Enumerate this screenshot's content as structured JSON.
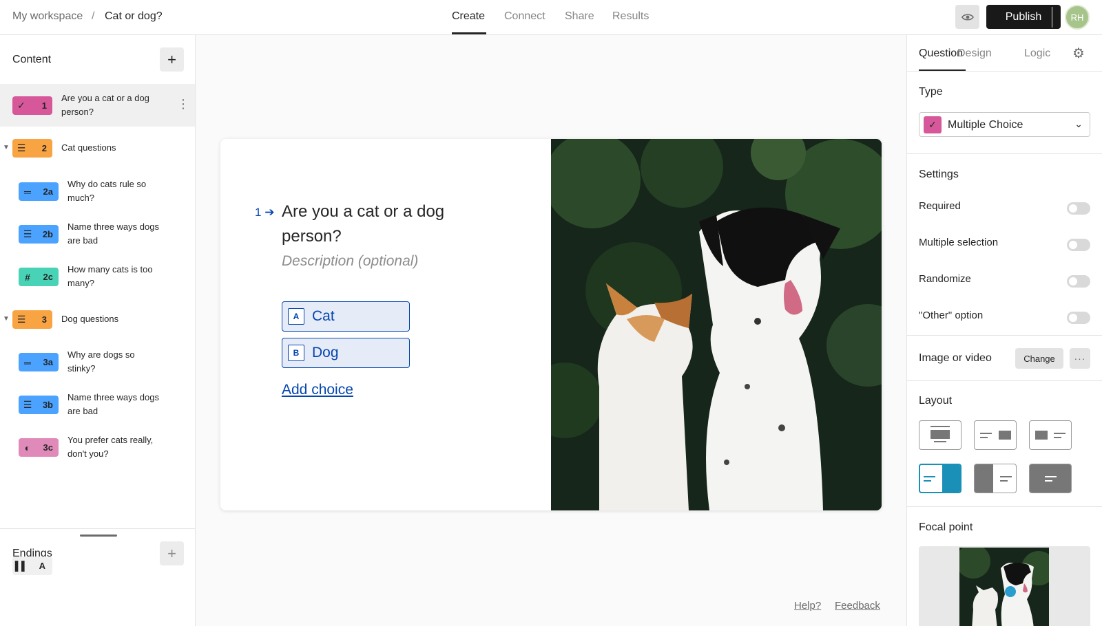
{
  "breadcrumb": {
    "workspace": "My workspace",
    "separator": "/",
    "form": "Cat or dog?"
  },
  "nav": {
    "create": "Create",
    "connect": "Connect",
    "share": "Share",
    "results": "Results"
  },
  "toolbar": {
    "publish_label": "Publish",
    "avatar_initials": "RH"
  },
  "sidebar": {
    "content_heading": "Content",
    "add_label": "+",
    "items": [
      {
        "num": "1",
        "text": "Are you a cat or a dog person?",
        "icon": "check-icon",
        "color": "#d6589a"
      },
      {
        "num": "2",
        "text": "Cat questions",
        "icon": "group-icon",
        "color": "#f9a443"
      },
      {
        "num": "2a",
        "text": "Why do cats rule so much?",
        "icon": "short-text-icon",
        "color": "#4ba3ff"
      },
      {
        "num": "2b",
        "text": "Name three ways dogs are bad",
        "icon": "long-text-icon",
        "color": "#4ba3ff"
      },
      {
        "num": "2c",
        "text": "How many cats is too many?",
        "icon": "hash-icon",
        "color": "#48d3b7"
      },
      {
        "num": "3",
        "text": "Dog questions",
        "icon": "group-icon",
        "color": "#f9a443"
      },
      {
        "num": "3a",
        "text": "Why are dogs so stinky?",
        "icon": "short-text-icon",
        "color": "#4ba3ff"
      },
      {
        "num": "3b",
        "text": "Name three ways dogs are bad",
        "icon": "long-text-icon",
        "color": "#4ba3ff"
      },
      {
        "num": "3c",
        "text": "You prefer cats really, don't you?",
        "icon": "yes-no-icon",
        "color": "#e08aba"
      }
    ],
    "endings_heading": "Endings",
    "ending_badge": "A"
  },
  "question": {
    "number": "1",
    "title": "Are you a cat or a dog person?",
    "description_placeholder": "Description (optional)",
    "choices": [
      {
        "key": "A",
        "label": "Cat"
      },
      {
        "key": "B",
        "label": "Dog"
      }
    ],
    "add_choice": "Add choice"
  },
  "footer": {
    "help": "Help?",
    "feedback": "Feedback"
  },
  "panel": {
    "tabs": {
      "question": "Question",
      "design": "Design",
      "logic": "Logic"
    },
    "type_label": "Type",
    "type_value": "Multiple Choice",
    "settings_label": "Settings",
    "settings": [
      {
        "label": "Required",
        "on": false
      },
      {
        "label": "Multiple selection",
        "on": false
      },
      {
        "label": "Randomize",
        "on": false
      },
      {
        "label": "\"Other\" option",
        "on": false
      }
    ],
    "image_label": "Image or video",
    "change_label": "Change",
    "more_label": "···",
    "layout_label": "Layout",
    "focal_label": "Focal point"
  },
  "colors": {
    "accent_blue": "#0445af",
    "selected_layout": "#1a8fb8",
    "multiple_choice": "#d6589a"
  }
}
